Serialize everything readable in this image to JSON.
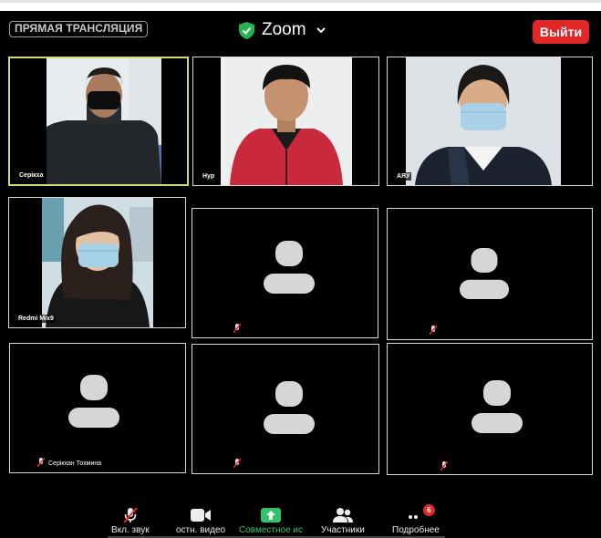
{
  "header": {
    "live_label": "ПРЯМАЯ ТРАНСЛЯЦИЯ",
    "app_title": "Zoom",
    "exit_label": "Выйти"
  },
  "participants": [
    {
      "name": "Серікха",
      "video": true,
      "active": true
    },
    {
      "name": "Нур",
      "video": true
    },
    {
      "name": "АЯУ",
      "video": true
    },
    {
      "name": "Redmi Mix9",
      "video": true
    },
    {
      "name": "",
      "video": false,
      "muted": true
    },
    {
      "name": "",
      "video": false,
      "muted": true
    },
    {
      "name": "Серікхан Тохмина",
      "video": false,
      "muted": true
    },
    {
      "name": "",
      "video": false,
      "muted": true
    },
    {
      "name": "",
      "video": false,
      "muted": true
    }
  ],
  "toolbar": {
    "unmute": "Вкл. звук",
    "stop_video": "остн. видео",
    "share": "Совместное ис",
    "participants": "Участники",
    "more": "Подробнее",
    "more_badge": "6"
  },
  "colors": {
    "exit_red": "#e02828",
    "share_green": "#2fc46b",
    "active_border": "#d3dc69"
  }
}
